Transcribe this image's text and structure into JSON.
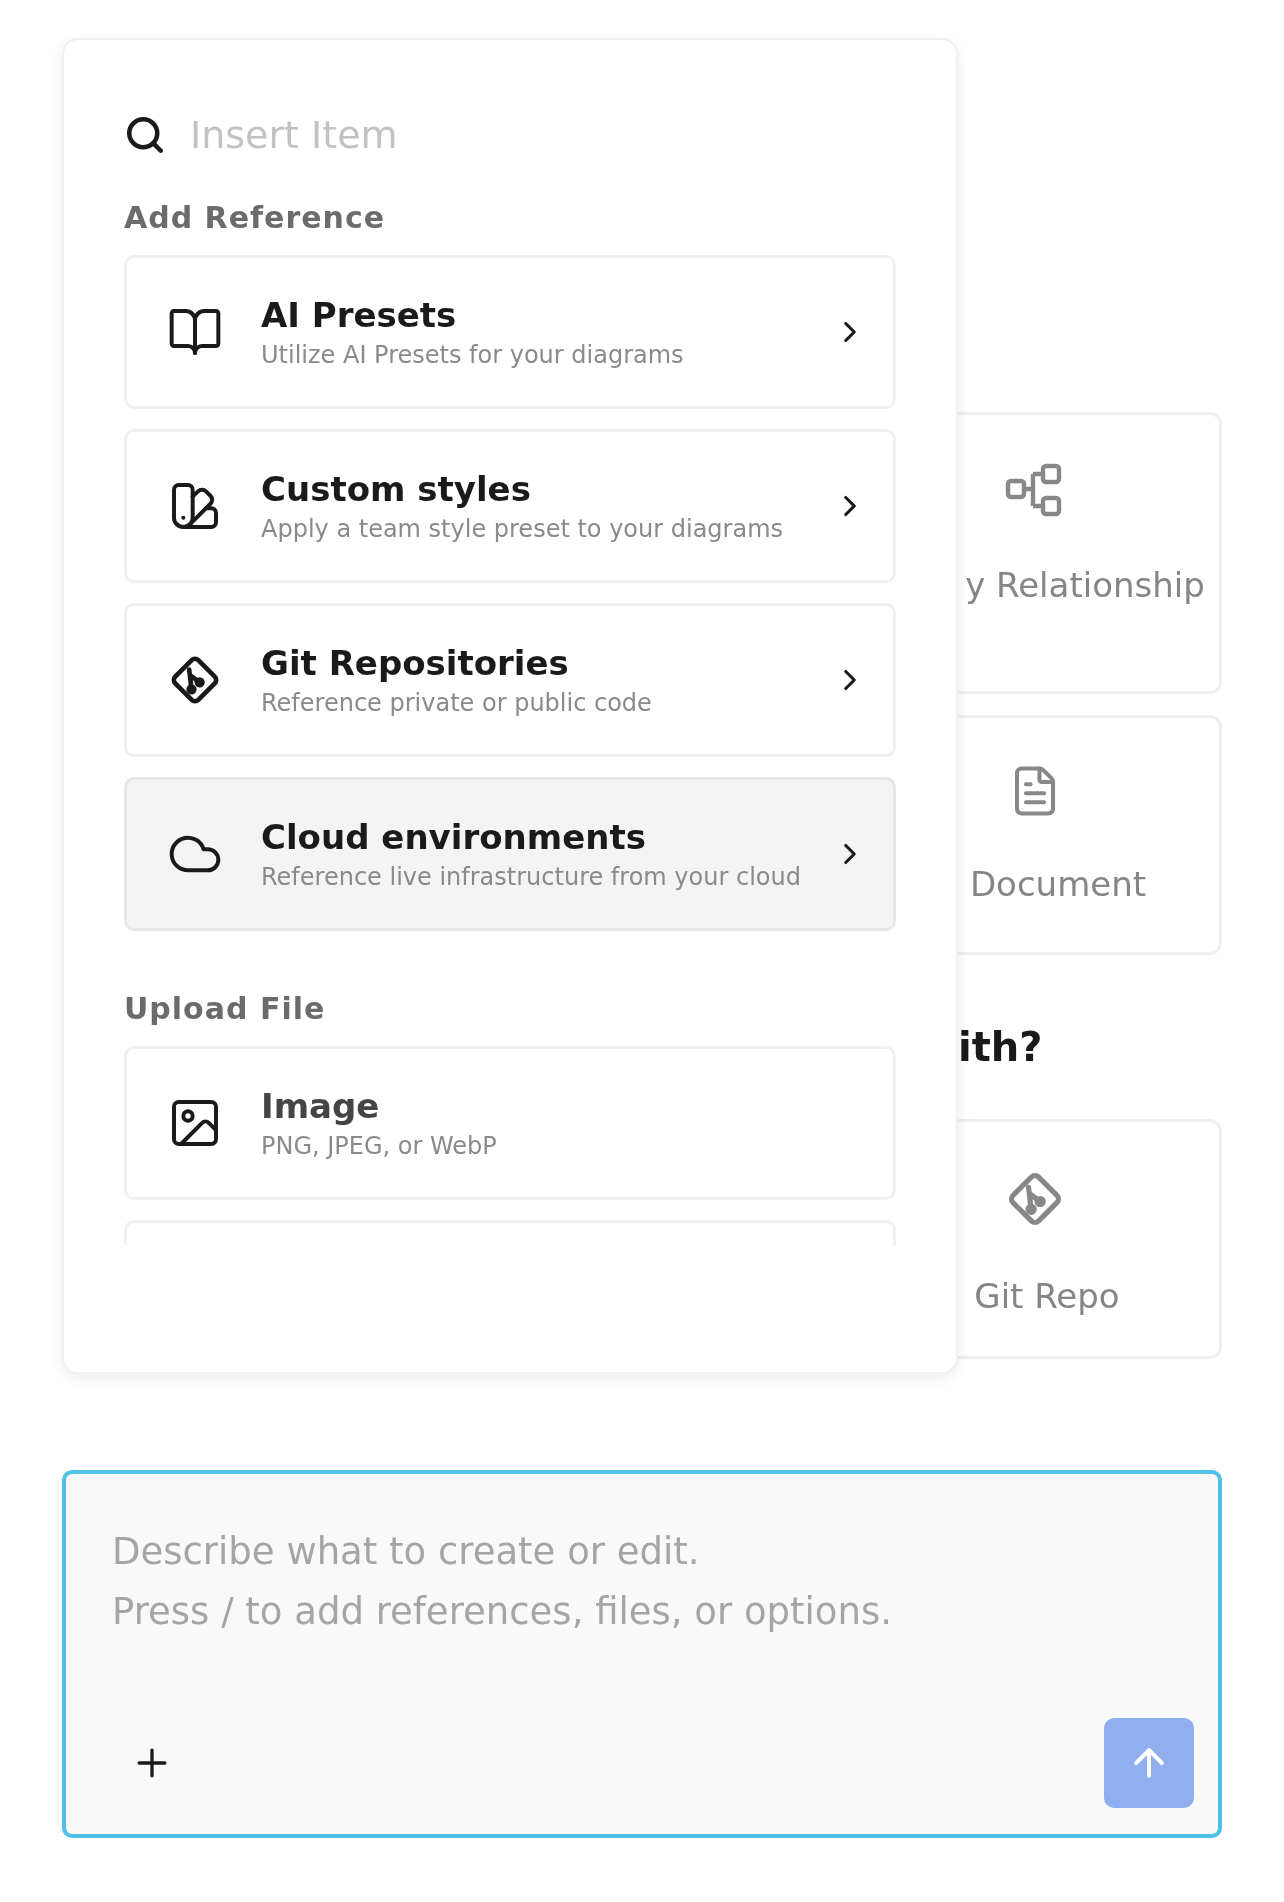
{
  "background": {
    "cards": [
      {
        "kind": "diagram",
        "label": "y Relationship"
      },
      {
        "kind": "document",
        "label": "Document"
      }
    ],
    "heading": "ith?",
    "cards_below": [
      {
        "kind": "git",
        "label": "Git Repo"
      }
    ]
  },
  "insert_menu": {
    "search": {
      "placeholder": "Insert Item"
    },
    "sections": [
      {
        "title": "Add Reference",
        "items": [
          {
            "kind": "submenu",
            "title": "AI Presets",
            "subtitle": "Utilize AI Presets for your diagrams",
            "selected": false
          },
          {
            "kind": "submenu",
            "title": "Custom styles",
            "subtitle": "Apply a team style preset to your diagrams",
            "selected": false
          },
          {
            "kind": "submenu",
            "title": "Git Repositories",
            "subtitle": "Reference private or public code",
            "selected": false
          },
          {
            "kind": "submenu",
            "title": "Cloud environments",
            "subtitle": "Reference live infrastructure from your cloud",
            "selected": true
          }
        ]
      },
      {
        "title": "Upload File",
        "items": [
          {
            "kind": "upload",
            "title": "Image",
            "subtitle": "PNG, JPEG, or WebP",
            "selected": false
          }
        ]
      }
    ],
    "more_below": true
  },
  "prompt": {
    "placeholder": "Describe what to create or edit.\nPress / to add references, files, or options."
  }
}
